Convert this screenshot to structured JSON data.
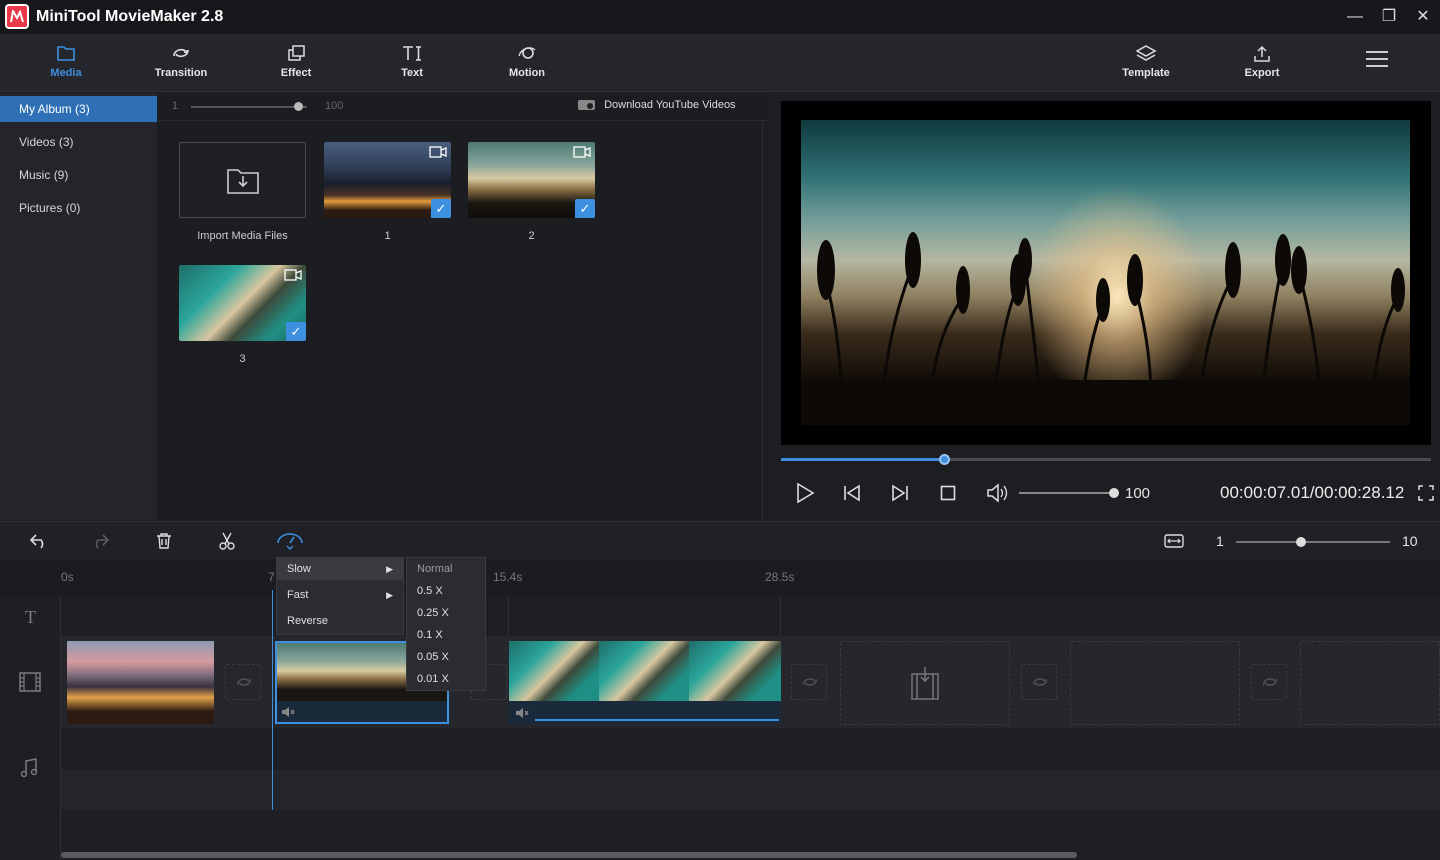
{
  "app": {
    "title": "MiniTool MovieMaker 2.8"
  },
  "window": {
    "minimize": "—",
    "restore": "❐",
    "close": "✕"
  },
  "toolbar": {
    "media": "Media",
    "transition": "Transition",
    "effect": "Effect",
    "text": "Text",
    "motion": "Motion",
    "template": "Template",
    "export": "Export"
  },
  "sidebar": {
    "items": [
      {
        "label": "My Album",
        "count": "(3)"
      },
      {
        "label": "Videos",
        "count": "(3)"
      },
      {
        "label": "Music",
        "count": "(9)"
      },
      {
        "label": "Pictures",
        "count": "(0)"
      }
    ]
  },
  "media": {
    "zoom_min": "1",
    "zoom_max": "100",
    "zoom_level": 0.92,
    "download_label": "Download YouTube Videos",
    "import_label": "Import Media Files",
    "items": [
      {
        "label": "1"
      },
      {
        "label": "2"
      },
      {
        "label": "3"
      }
    ]
  },
  "player": {
    "progress": 0.25,
    "volume_value": "100",
    "time": "00:00:07.01/00:00:28.12"
  },
  "timeline": {
    "zoom_min": "1",
    "zoom_max": "10",
    "zoom_level": 0.42,
    "ruler": [
      "0s",
      "7",
      "15.4s",
      "28.5s"
    ]
  },
  "speed_menu": {
    "items": [
      {
        "label": "Slow",
        "arrow": "▶"
      },
      {
        "label": "Fast",
        "arrow": "▶"
      },
      {
        "label": "Reverse",
        "arrow": ""
      }
    ],
    "slow_options": [
      "Normal",
      "0.5 X",
      "0.25 X",
      "0.1 X",
      "0.05 X",
      "0.01 X"
    ]
  },
  "colors": {
    "accent": "#3d8fe0",
    "background": "#1e1f24",
    "logo": "#e8384a"
  }
}
